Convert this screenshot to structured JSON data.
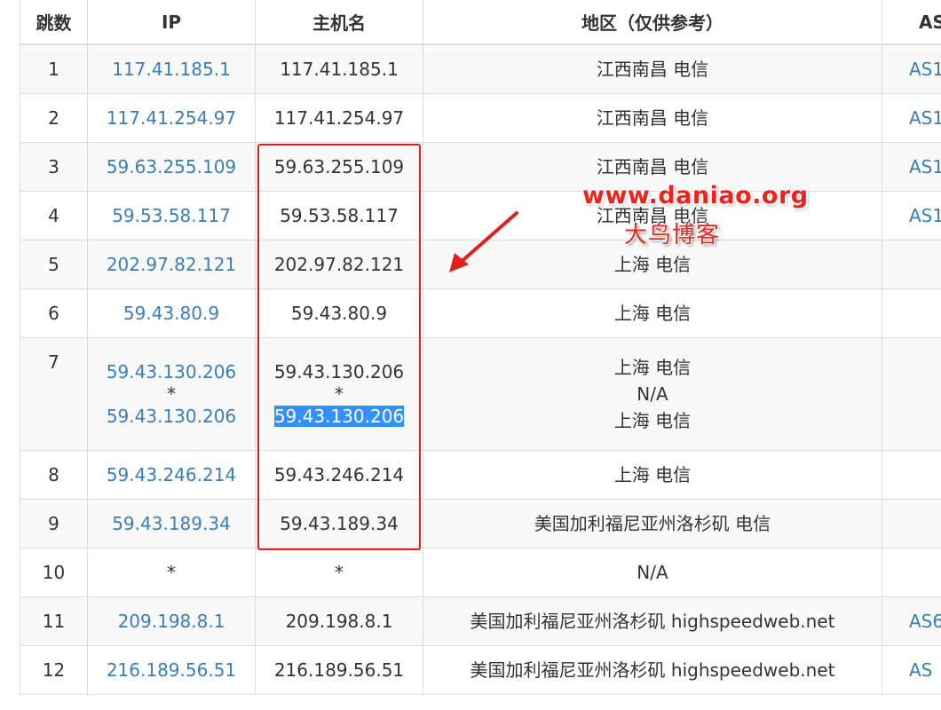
{
  "table": {
    "headers": {
      "hop": "跳数",
      "ip": "IP",
      "hostname": "主机名",
      "region": "地区（仅供参考）",
      "as": "AS"
    },
    "rows": [
      {
        "hop": "1",
        "ip": [
          "117.41.185.1"
        ],
        "host": [
          "117.41.185.1"
        ],
        "region": [
          "江西南昌 电信"
        ],
        "as": "AS1"
      },
      {
        "hop": "2",
        "ip": [
          "117.41.254.97"
        ],
        "host": [
          "117.41.254.97"
        ],
        "region": [
          "江西南昌 电信"
        ],
        "as": "AS1"
      },
      {
        "hop": "3",
        "ip": [
          "59.63.255.109"
        ],
        "host": [
          "59.63.255.109"
        ],
        "region": [
          "江西南昌 电信"
        ],
        "as": "AS1"
      },
      {
        "hop": "4",
        "ip": [
          "59.53.58.117"
        ],
        "host": [
          "59.53.58.117"
        ],
        "region": [
          "江西南昌 电信"
        ],
        "as": "AS1"
      },
      {
        "hop": "5",
        "ip": [
          "202.97.82.121"
        ],
        "host": [
          "202.97.82.121"
        ],
        "region": [
          "上海 电信"
        ],
        "as": ""
      },
      {
        "hop": "6",
        "ip": [
          "59.43.80.9"
        ],
        "host": [
          "59.43.80.9"
        ],
        "region": [
          "上海 电信"
        ],
        "as": ""
      },
      {
        "hop": "7",
        "ip": [
          "59.43.130.206",
          "*",
          "59.43.130.206"
        ],
        "host": [
          "59.43.130.206",
          "*",
          "59.43.130.206"
        ],
        "region": [
          "上海 电信",
          "N/A",
          "上海 电信"
        ],
        "as": ""
      },
      {
        "hop": "8",
        "ip": [
          "59.43.246.214"
        ],
        "host": [
          "59.43.246.214"
        ],
        "region": [
          "上海 电信"
        ],
        "as": ""
      },
      {
        "hop": "9",
        "ip": [
          "59.43.189.34"
        ],
        "host": [
          "59.43.189.34"
        ],
        "region": [
          "美国加利福尼亚州洛杉矶 电信"
        ],
        "as": ""
      },
      {
        "hop": "10",
        "ip": [
          "*"
        ],
        "host": [
          "*"
        ],
        "region": [
          "N/A"
        ],
        "as": ""
      },
      {
        "hop": "11",
        "ip": [
          "209.198.8.1"
        ],
        "host": [
          "209.198.8.1"
        ],
        "region": [
          "美国加利福尼亚州洛杉矶 highspeedweb.net"
        ],
        "as": "AS6"
      },
      {
        "hop": "12",
        "ip": [
          "216.189.56.51"
        ],
        "host": [
          "216.189.56.51"
        ],
        "region": [
          "美国加利福尼亚州洛杉矶 highspeedweb.net"
        ],
        "as": "AS"
      }
    ],
    "selected_text": "59.43.130.206"
  },
  "annotation": {
    "watermark_url": "www.daniao.org",
    "watermark_name": "大鸟博客",
    "highlight_color": "#e0201c",
    "link_color": "#3a7eb6",
    "selection_color": "#3390ff"
  }
}
